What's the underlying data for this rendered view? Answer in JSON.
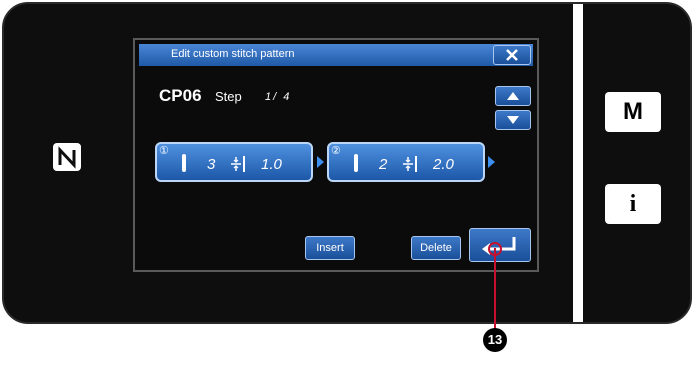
{
  "dialog": {
    "title": "Edit custom stitch pattern",
    "close_symbol": "✕"
  },
  "pattern": {
    "name": "CP06",
    "step_label": "Step",
    "step_value": "1/ 4"
  },
  "steps": [
    {
      "index": "①",
      "stitch_length": "3",
      "stitch_width": "1.0"
    },
    {
      "index": "②",
      "stitch_length": "2",
      "stitch_width": "2.0"
    }
  ],
  "buttons": {
    "insert": "Insert",
    "delete": "Delete"
  },
  "side_buttons": {
    "mode": "M",
    "info": "i"
  },
  "callout": {
    "number": "13"
  },
  "icons": [
    "nfc-icon",
    "close-icon",
    "up-arrow-icon",
    "down-arrow-icon",
    "needle-icon",
    "stitch-length-icon",
    "enter-icon"
  ],
  "colors": {
    "accent_blue": "#1f5aa8",
    "callout_red": "#c8102e"
  }
}
